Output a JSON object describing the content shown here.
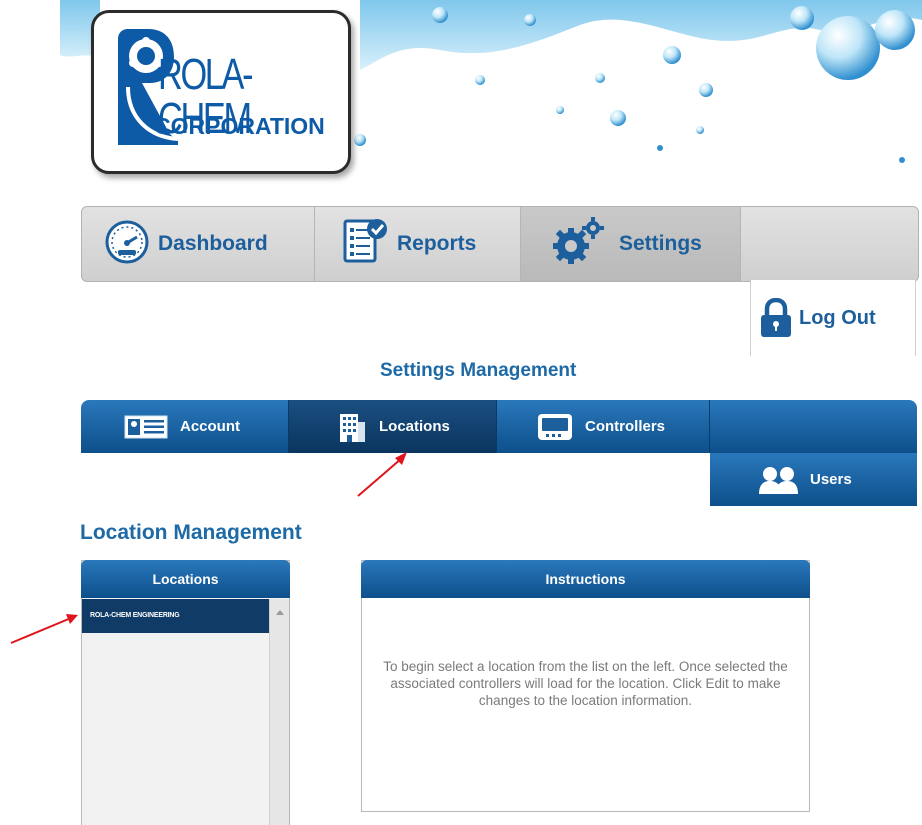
{
  "brand": {
    "logo_line1": "ROLA-CHEM",
    "logo_line2": "CORPORATION"
  },
  "main_nav": {
    "tabs": [
      {
        "label": "Dashboard",
        "icon": "speedometer-icon"
      },
      {
        "label": "Reports",
        "icon": "report-document-icon"
      },
      {
        "label": "Settings",
        "icon": "gears-icon",
        "active": true
      }
    ],
    "logout_label": "Log Out",
    "logout_icon": "padlock-icon"
  },
  "settings": {
    "title": "Settings Management",
    "tabs": [
      {
        "label": "Account",
        "icon": "id-card-icon"
      },
      {
        "label": "Locations",
        "icon": "building-icon",
        "active": true
      },
      {
        "label": "Controllers",
        "icon": "controller-device-icon"
      },
      {
        "label": "Users",
        "icon": "users-icon"
      }
    ]
  },
  "location_management": {
    "title": "Location Management",
    "locations_panel": {
      "header": "Locations",
      "items": [
        "ROLA-CHEM ENGINEERING"
      ]
    },
    "instructions_panel": {
      "header": "Instructions",
      "text": "To begin select a location from the list on the left. Once selected the associated controllers will load for the location. Click Edit to make changes to the location information."
    }
  },
  "colors": {
    "brand_blue": "#1d5f9c",
    "tab_blue": "#0d4f8a",
    "selected_item": "#0f3b66",
    "annotation_arrow": "#e0141b"
  }
}
